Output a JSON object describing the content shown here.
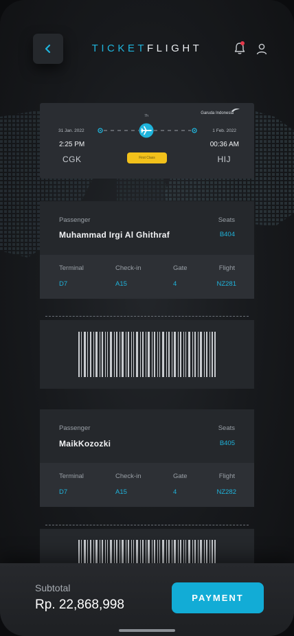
{
  "header": {
    "brand_part1": "TICKET",
    "brand_part2": "FLIGHT"
  },
  "flight": {
    "airline": "Garuda Indonesia",
    "duration": "7h",
    "depart": {
      "date": "31 Jan. 2022",
      "time": "2:25 PM",
      "code": "CGK"
    },
    "arrive": {
      "date": "1 Feb. 2022",
      "time": "00:36 AM",
      "code": "HIJ"
    },
    "class_label": "First Class"
  },
  "labels": {
    "passenger": "Passenger",
    "seats": "Seats",
    "terminal": "Terminal",
    "checkin": "Check-in",
    "gate": "Gate",
    "flight": "Flight"
  },
  "tickets": [
    {
      "passenger": "Muhammad Irgi Al Ghithraf",
      "seat": "B404",
      "terminal": "D7",
      "checkin": "A15",
      "gate": "4",
      "flight": "NZ281"
    },
    {
      "passenger": "MaikKozozki",
      "seat": "B405",
      "terminal": "D7",
      "checkin": "A15",
      "gate": "4",
      "flight": "NZ282"
    }
  ],
  "footer": {
    "subtotal_label": "Subtotal",
    "subtotal_value": "Rp. 22,868,998",
    "payment_label": "PAYMENT"
  },
  "colors": {
    "accent": "#1fb4dc",
    "class_badge": "#f2c11b",
    "notification": "#e5384a"
  },
  "icons": {
    "back": "chevron-left-icon",
    "bell": "bell-icon",
    "user": "user-icon",
    "plane": "plane-icon"
  }
}
